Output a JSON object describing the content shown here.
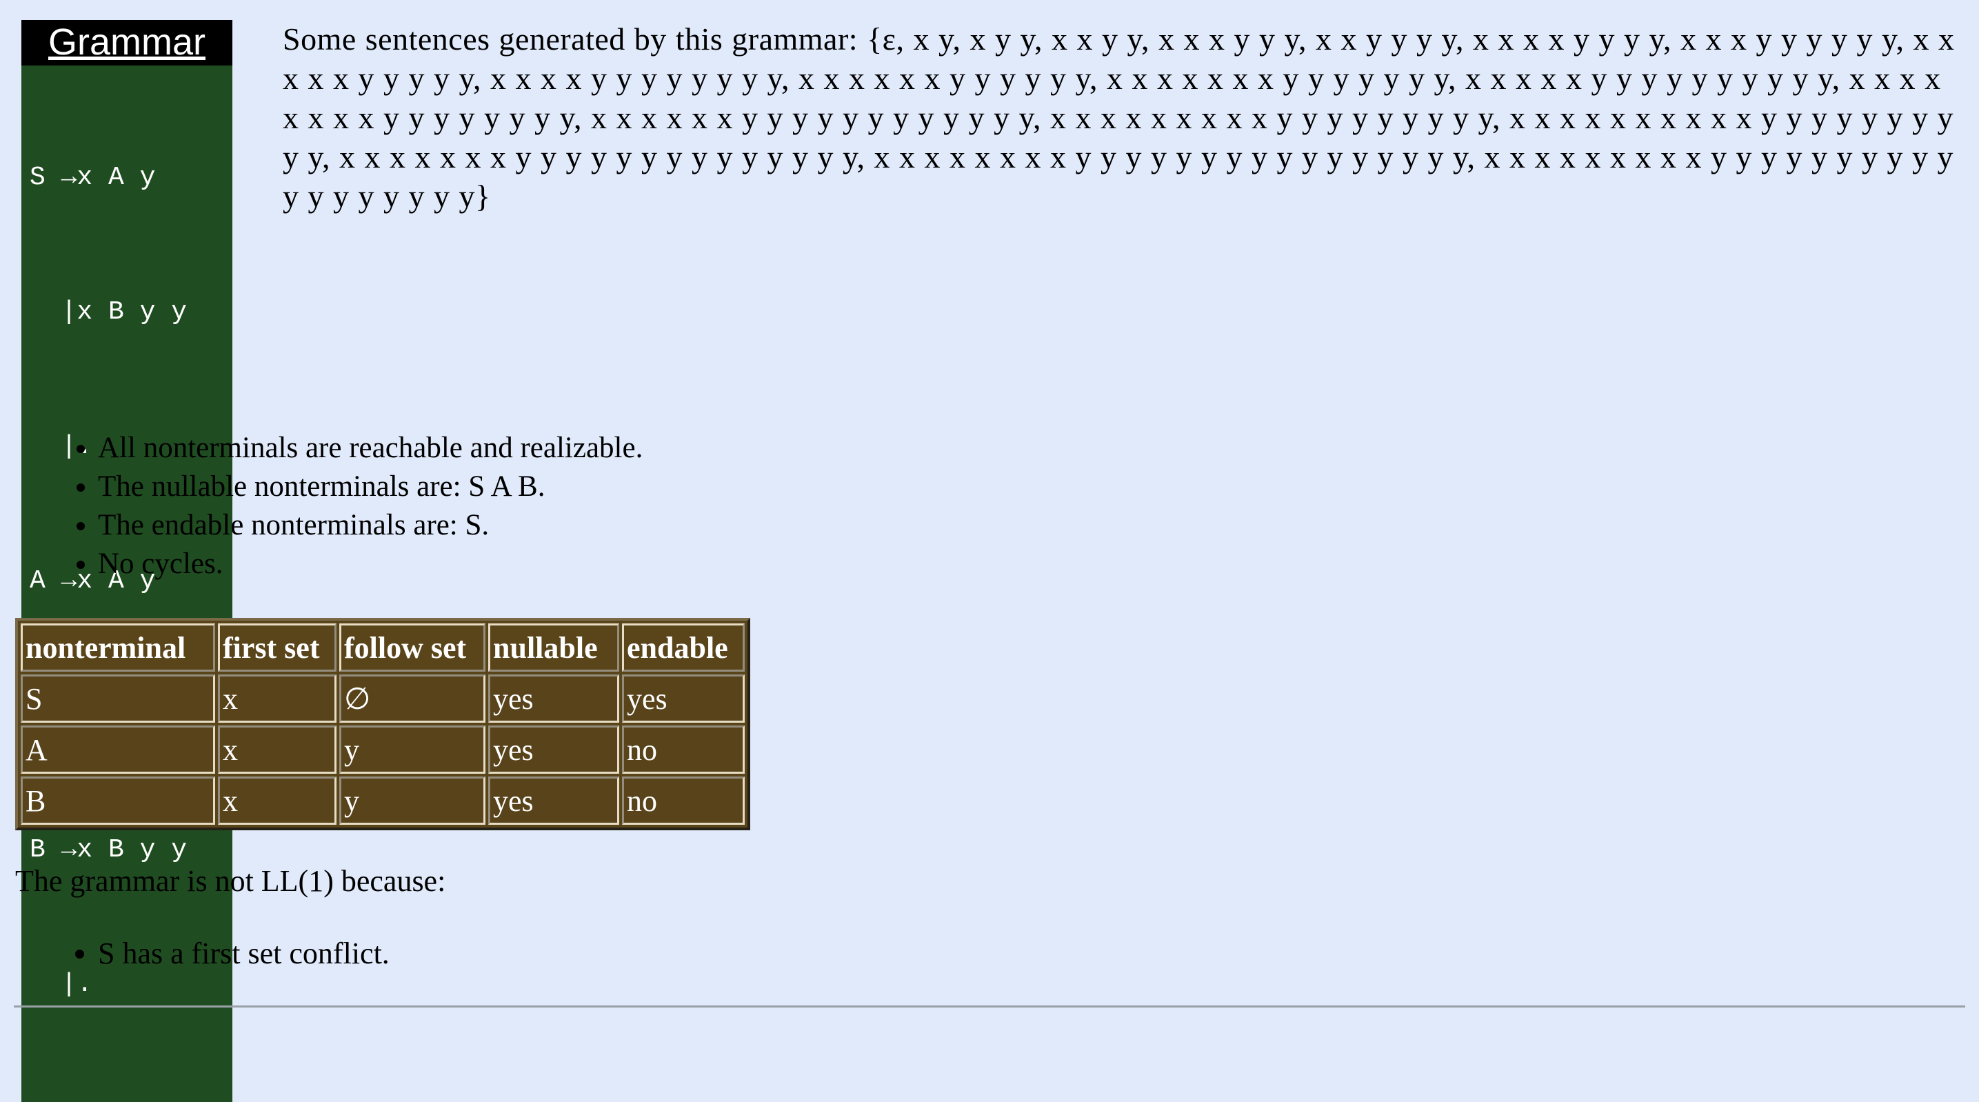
{
  "grammar": {
    "title": "Grammar",
    "rules": [
      "S →x A y",
      "  |x B y y",
      "  |.",
      "A →x A y",
      "  |.",
      "B →x B y y",
      "  |."
    ]
  },
  "sentences": {
    "text": "Some sentences generated by this grammar: {ε, x y, x y y, x x y y, x x x y y y, x x y y y y, x x x x y y y y, x x x y y y y y y, x x x x x y y y y y, x x x x y y y y y y y y, x x x x x x y y y y y y, x x x x x x x y y y y y y y, x x x x x y y y y y y y y y y, x x x x x x x x y y y y y y y y, x x x x x x y y y y y y y y y y y y, x x x x x x x x x y y y y y y y y y, x x x x x x x x x x y y y y y y y y y y, x x x x x x x y y y y y y y y y y y y y y, x x x x x x x x y y y y y y y y y y y y y y y y, x x x x x x x x x y y y y y y y y y y y y y y y y y y}"
  },
  "properties": [
    "All nonterminals are reachable and realizable.",
    "The nullable nonterminals are: S A B.",
    "The endable nonterminals are: S.",
    "No cycles."
  ],
  "table": {
    "headers": [
      "nonterminal",
      "first set",
      "follow set",
      "nullable",
      "endable"
    ],
    "rows": [
      [
        "S",
        "x",
        "∅",
        "yes",
        "yes"
      ],
      [
        "A",
        "x",
        "y",
        "yes",
        "no"
      ],
      [
        "B",
        "x",
        "y",
        "yes",
        "no"
      ]
    ]
  },
  "ll1": {
    "statement": "The grammar is not LL(1) because:",
    "reasons": [
      "S has a first set conflict."
    ]
  },
  "colors": {
    "page_background": "#e1eafb",
    "grammar_background": "#1f4d21",
    "table_background": "#5a451b"
  }
}
